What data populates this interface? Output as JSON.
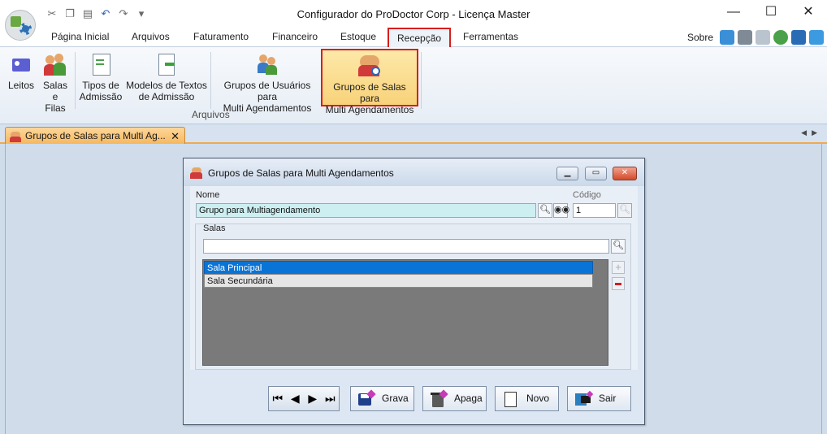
{
  "window": {
    "title": "Configurador do ProDoctor Corp - Licença Master",
    "controls": [
      "minimize",
      "maximize",
      "close"
    ]
  },
  "quick_access": [
    "cut-icon",
    "copy-icon",
    "paste-icon",
    "undo-icon",
    "redo-icon",
    "customize-icon"
  ],
  "menu_tabs": [
    {
      "label": "Página Inicial",
      "active": false
    },
    {
      "label": "Arquivos",
      "active": false
    },
    {
      "label": "Faturamento",
      "active": false
    },
    {
      "label": "Financeiro",
      "active": false
    },
    {
      "label": "Estoque",
      "active": false
    },
    {
      "label": "Recepção",
      "active": true
    },
    {
      "label": "Ferramentas",
      "active": false
    }
  ],
  "right_links": {
    "sobre": "Sobre"
  },
  "ribbon": {
    "group_label": "Arquivos",
    "buttons": [
      {
        "line1": "Leitos",
        "line2": ""
      },
      {
        "line1": "Salas e",
        "line2": "Filas"
      },
      {
        "line1": "Tipos de",
        "line2": "Admissão"
      },
      {
        "line1": "Modelos de Textos",
        "line2": "de Admissão"
      },
      {
        "line1": "Grupos de Usuários para",
        "line2": "Multi Agendamentos"
      },
      {
        "line1": "Grupos de Salas para",
        "line2": "Multi Agendamentos"
      }
    ]
  },
  "doc_tab": {
    "label": "Grupos de Salas para Multi Ag...",
    "close": "✕"
  },
  "dialog": {
    "title": "Grupos de Salas para Multi Agendamentos",
    "nome_label": "Nome",
    "nome_value": "Grupo para Multiagendamento",
    "codigo_label": "Código",
    "codigo_value": "1",
    "salas_label": "Salas",
    "salas_search_value": "",
    "salas": [
      "Sala Principal",
      "Sala Secundária"
    ],
    "nav": [
      "⏮",
      "◀",
      "▶",
      "⏭"
    ],
    "buttons": {
      "grava": "Grava",
      "apaga": "Apaga",
      "novo": "Novo",
      "sair": "Sair"
    }
  },
  "colors": {
    "highlight_border": "#d81e1e",
    "selected_row": "#0a74d6",
    "doc_tab": "#f5b45a"
  }
}
